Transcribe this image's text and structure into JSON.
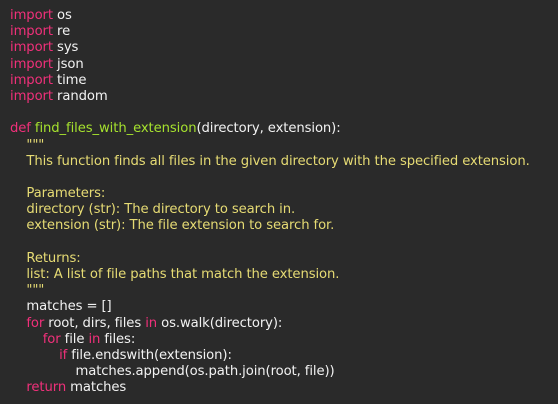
{
  "theme": {
    "background": "#2a2a2a",
    "keyword": "#f0307a",
    "function": "#a6e22e",
    "docstring": "#e6db74",
    "text": "#f2f2f2"
  },
  "code": {
    "lines": [
      [
        {
          "t": "kw",
          "v": "import"
        },
        {
          "t": "plain",
          "v": " os"
        }
      ],
      [
        {
          "t": "kw",
          "v": "import"
        },
        {
          "t": "plain",
          "v": " re"
        }
      ],
      [
        {
          "t": "kw",
          "v": "import"
        },
        {
          "t": "plain",
          "v": " sys"
        }
      ],
      [
        {
          "t": "kw",
          "v": "import"
        },
        {
          "t": "plain",
          "v": " json"
        }
      ],
      [
        {
          "t": "kw",
          "v": "import"
        },
        {
          "t": "plain",
          "v": " time"
        }
      ],
      [
        {
          "t": "kw",
          "v": "import"
        },
        {
          "t": "plain",
          "v": " random"
        }
      ],
      [],
      [
        {
          "t": "kw",
          "v": "def"
        },
        {
          "t": "plain",
          "v": " "
        },
        {
          "t": "fn",
          "v": "find_files_with_extension"
        },
        {
          "t": "plain",
          "v": "(directory, extension):"
        }
      ],
      [
        {
          "t": "doc",
          "v": "    \"\"\""
        }
      ],
      [
        {
          "t": "doc",
          "v": "    This function finds all files in the given directory with the specified extension."
        }
      ],
      [],
      [
        {
          "t": "doc",
          "v": "    Parameters:"
        }
      ],
      [
        {
          "t": "doc",
          "v": "    directory (str): The directory to search in."
        }
      ],
      [
        {
          "t": "doc",
          "v": "    extension (str): The file extension to search for."
        }
      ],
      [],
      [
        {
          "t": "doc",
          "v": "    Returns:"
        }
      ],
      [
        {
          "t": "doc",
          "v": "    list: A list of file paths that match the extension."
        }
      ],
      [
        {
          "t": "doc",
          "v": "    \"\"\""
        }
      ],
      [
        {
          "t": "plain",
          "v": "    matches = []"
        }
      ],
      [
        {
          "t": "kw",
          "v": "    for"
        },
        {
          "t": "plain",
          "v": " root, dirs, files "
        },
        {
          "t": "kw",
          "v": "in"
        },
        {
          "t": "plain",
          "v": " os.walk(directory):"
        }
      ],
      [
        {
          "t": "kw",
          "v": "        for"
        },
        {
          "t": "plain",
          "v": " file "
        },
        {
          "t": "kw",
          "v": "in"
        },
        {
          "t": "plain",
          "v": " files:"
        }
      ],
      [
        {
          "t": "kw",
          "v": "            if"
        },
        {
          "t": "plain",
          "v": " file.endswith(extension):"
        }
      ],
      [
        {
          "t": "plain",
          "v": "                matches.append(os.path.join(root, file))"
        }
      ],
      [
        {
          "t": "kw",
          "v": "    return"
        },
        {
          "t": "plain",
          "v": " matches"
        }
      ]
    ]
  }
}
